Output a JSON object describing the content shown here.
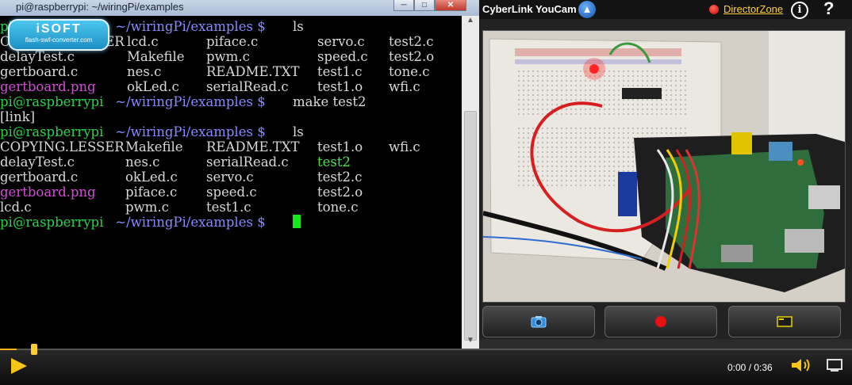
{
  "terminal": {
    "title": "pi@raspberrypi: ~/wiringPi/examples",
    "controls": {
      "minimize": "─",
      "maximize": "□",
      "close": "✕"
    },
    "prompt_user": "pi@raspberrypi",
    "prompt_path": " ~/wiringPi/examples $ ",
    "lines": [
      {
        "type": "prompt",
        "cmd": "ls"
      },
      {
        "type": "files",
        "cells": [
          {
            "text": "COPYING.LESSER",
            "kind": "file"
          },
          {
            "text": "lcd.c",
            "kind": "file"
          },
          {
            "text": "piface.c",
            "kind": "file"
          },
          {
            "text": "servo.c",
            "kind": "file"
          },
          {
            "text": "test2.c",
            "kind": "file"
          }
        ]
      },
      {
        "type": "files",
        "cells": [
          {
            "text": "delayTest.c",
            "kind": "file"
          },
          {
            "text": "Makefile",
            "kind": "file"
          },
          {
            "text": "pwm.c",
            "kind": "file"
          },
          {
            "text": "speed.c",
            "kind": "file"
          },
          {
            "text": "test2.o",
            "kind": "file"
          }
        ]
      },
      {
        "type": "files",
        "cells": [
          {
            "text": "gertboard.c",
            "kind": "file"
          },
          {
            "text": "nes.c",
            "kind": "file"
          },
          {
            "text": "README.TXT",
            "kind": "file"
          },
          {
            "text": "test1.c",
            "kind": "file"
          },
          {
            "text": "tone.c",
            "kind": "file"
          }
        ]
      },
      {
        "type": "files",
        "cells": [
          {
            "text": "gertboard.png",
            "kind": "image"
          },
          {
            "text": "okLed.c",
            "kind": "file"
          },
          {
            "text": "serialRead.c",
            "kind": "file"
          },
          {
            "text": "test1.o",
            "kind": "file"
          },
          {
            "text": "wfi.c",
            "kind": "file"
          }
        ]
      },
      {
        "type": "prompt",
        "cmd": "make test2"
      },
      {
        "type": "plain",
        "text": "[link]"
      },
      {
        "type": "prompt",
        "cmd": "ls"
      },
      {
        "type": "files2",
        "cells": [
          {
            "text": "COPYING.LESSER",
            "kind": "file"
          },
          {
            "text": "Makefile",
            "kind": "file"
          },
          {
            "text": "README.TXT",
            "kind": "file"
          },
          {
            "text": "test1.o",
            "kind": "file"
          },
          {
            "text": "wfi.c",
            "kind": "file"
          }
        ]
      },
      {
        "type": "files2",
        "cells": [
          {
            "text": "delayTest.c",
            "kind": "file"
          },
          {
            "text": "nes.c",
            "kind": "file"
          },
          {
            "text": "serialRead.c",
            "kind": "file"
          },
          {
            "text": "test2",
            "kind": "exec"
          }
        ]
      },
      {
        "type": "files2",
        "cells": [
          {
            "text": "gertboard.c",
            "kind": "file"
          },
          {
            "text": "okLed.c",
            "kind": "file"
          },
          {
            "text": "servo.c",
            "kind": "file"
          },
          {
            "text": "test2.c",
            "kind": "file"
          }
        ]
      },
      {
        "type": "files2",
        "cells": [
          {
            "text": "gertboard.png",
            "kind": "image"
          },
          {
            "text": "piface.c",
            "kind": "file"
          },
          {
            "text": "speed.c",
            "kind": "file"
          },
          {
            "text": "test2.o",
            "kind": "file"
          }
        ]
      },
      {
        "type": "files2",
        "cells": [
          {
            "text": "lcd.c",
            "kind": "file"
          },
          {
            "text": "pwm.c",
            "kind": "file"
          },
          {
            "text": "test1.c",
            "kind": "file"
          },
          {
            "text": "tone.c",
            "kind": "file"
          }
        ]
      },
      {
        "type": "prompt",
        "cmd": "",
        "cursor": true
      }
    ]
  },
  "watermark": {
    "main": "iSOFT",
    "sub": "flash-swf-converter.com"
  },
  "youcam": {
    "app_name": "CyberLink YouCam",
    "director_zone": "DirectorZone",
    "info_label": "i",
    "help_label": "?",
    "buttons": [
      {
        "name": "snapshot",
        "icon": "camera-icon"
      },
      {
        "name": "record",
        "icon": "record-icon"
      },
      {
        "name": "screen",
        "icon": "screen-icon"
      }
    ]
  },
  "player": {
    "time": "0:00 / 0:36",
    "progress": 0.02,
    "colors": {
      "accent": "#f5c518"
    }
  }
}
